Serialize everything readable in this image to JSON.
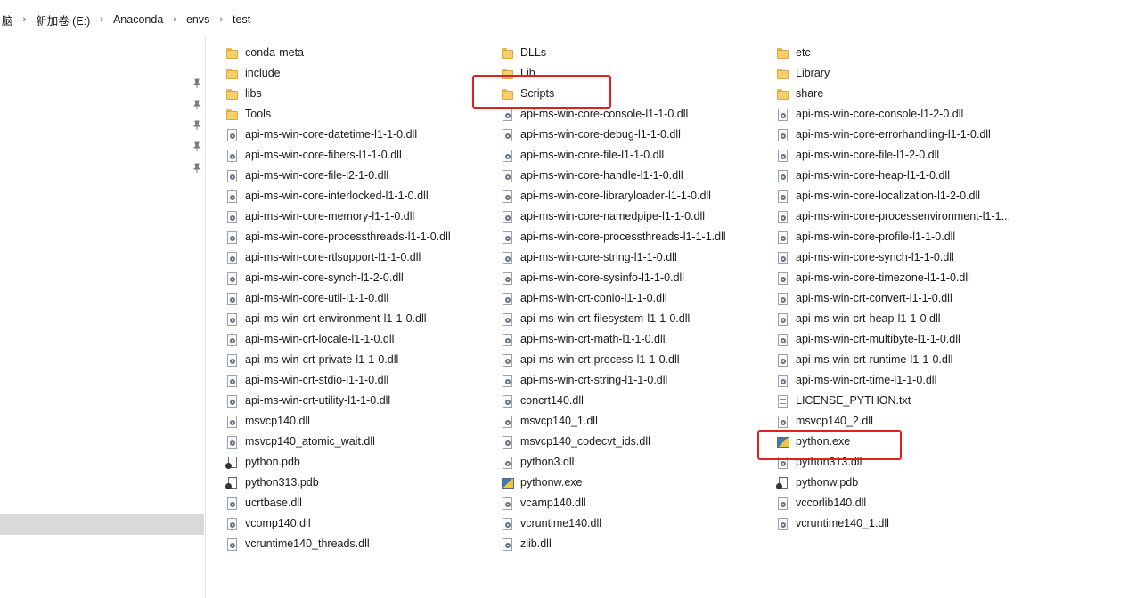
{
  "breadcrumb": [
    "脑",
    "新加卷 (E:)",
    "Anaconda",
    "envs",
    "test"
  ],
  "columns": [
    [
      {
        "name": "conda-meta",
        "type": "folder"
      },
      {
        "name": "include",
        "type": "folder"
      },
      {
        "name": "libs",
        "type": "folder"
      },
      {
        "name": "Tools",
        "type": "folder"
      },
      {
        "name": "api-ms-win-core-datetime-l1-1-0.dll",
        "type": "dll"
      },
      {
        "name": "api-ms-win-core-fibers-l1-1-0.dll",
        "type": "dll"
      },
      {
        "name": "api-ms-win-core-file-l2-1-0.dll",
        "type": "dll"
      },
      {
        "name": "api-ms-win-core-interlocked-l1-1-0.dll",
        "type": "dll"
      },
      {
        "name": "api-ms-win-core-memory-l1-1-0.dll",
        "type": "dll"
      },
      {
        "name": "api-ms-win-core-processthreads-l1-1-0.dll",
        "type": "dll"
      },
      {
        "name": "api-ms-win-core-rtlsupport-l1-1-0.dll",
        "type": "dll"
      },
      {
        "name": "api-ms-win-core-synch-l1-2-0.dll",
        "type": "dll"
      },
      {
        "name": "api-ms-win-core-util-l1-1-0.dll",
        "type": "dll"
      },
      {
        "name": "api-ms-win-crt-environment-l1-1-0.dll",
        "type": "dll"
      },
      {
        "name": "api-ms-win-crt-locale-l1-1-0.dll",
        "type": "dll"
      },
      {
        "name": "api-ms-win-crt-private-l1-1-0.dll",
        "type": "dll"
      },
      {
        "name": "api-ms-win-crt-stdio-l1-1-0.dll",
        "type": "dll"
      },
      {
        "name": "api-ms-win-crt-utility-l1-1-0.dll",
        "type": "dll"
      },
      {
        "name": "msvcp140.dll",
        "type": "dll"
      },
      {
        "name": "msvcp140_atomic_wait.dll",
        "type": "dll"
      },
      {
        "name": "python.pdb",
        "type": "pdb"
      },
      {
        "name": "python313.pdb",
        "type": "pdb"
      },
      {
        "name": "ucrtbase.dll",
        "type": "dll"
      },
      {
        "name": "vcomp140.dll",
        "type": "dll"
      },
      {
        "name": "vcruntime140_threads.dll",
        "type": "dll"
      }
    ],
    [
      {
        "name": "DLLs",
        "type": "folder"
      },
      {
        "name": "Lib",
        "type": "folder"
      },
      {
        "name": "Scripts",
        "type": "folder"
      },
      {
        "name": "api-ms-win-core-console-l1-1-0.dll",
        "type": "dll"
      },
      {
        "name": "api-ms-win-core-debug-l1-1-0.dll",
        "type": "dll"
      },
      {
        "name": "api-ms-win-core-file-l1-1-0.dll",
        "type": "dll"
      },
      {
        "name": "api-ms-win-core-handle-l1-1-0.dll",
        "type": "dll"
      },
      {
        "name": "api-ms-win-core-libraryloader-l1-1-0.dll",
        "type": "dll"
      },
      {
        "name": "api-ms-win-core-namedpipe-l1-1-0.dll",
        "type": "dll"
      },
      {
        "name": "api-ms-win-core-processthreads-l1-1-1.dll",
        "type": "dll"
      },
      {
        "name": "api-ms-win-core-string-l1-1-0.dll",
        "type": "dll"
      },
      {
        "name": "api-ms-win-core-sysinfo-l1-1-0.dll",
        "type": "dll"
      },
      {
        "name": "api-ms-win-crt-conio-l1-1-0.dll",
        "type": "dll"
      },
      {
        "name": "api-ms-win-crt-filesystem-l1-1-0.dll",
        "type": "dll"
      },
      {
        "name": "api-ms-win-crt-math-l1-1-0.dll",
        "type": "dll"
      },
      {
        "name": "api-ms-win-crt-process-l1-1-0.dll",
        "type": "dll"
      },
      {
        "name": "api-ms-win-crt-string-l1-1-0.dll",
        "type": "dll"
      },
      {
        "name": "concrt140.dll",
        "type": "dll"
      },
      {
        "name": "msvcp140_1.dll",
        "type": "dll"
      },
      {
        "name": "msvcp140_codecvt_ids.dll",
        "type": "dll"
      },
      {
        "name": "python3.dll",
        "type": "dll"
      },
      {
        "name": "pythonw.exe",
        "type": "exe"
      },
      {
        "name": "vcamp140.dll",
        "type": "dll"
      },
      {
        "name": "vcruntime140.dll",
        "type": "dll"
      },
      {
        "name": "zlib.dll",
        "type": "dll"
      }
    ],
    [
      {
        "name": "etc",
        "type": "folder"
      },
      {
        "name": "Library",
        "type": "folder"
      },
      {
        "name": "share",
        "type": "folder"
      },
      {
        "name": "api-ms-win-core-console-l1-2-0.dll",
        "type": "dll"
      },
      {
        "name": "api-ms-win-core-errorhandling-l1-1-0.dll",
        "type": "dll"
      },
      {
        "name": "api-ms-win-core-file-l1-2-0.dll",
        "type": "dll"
      },
      {
        "name": "api-ms-win-core-heap-l1-1-0.dll",
        "type": "dll"
      },
      {
        "name": "api-ms-win-core-localization-l1-2-0.dll",
        "type": "dll"
      },
      {
        "name": "api-ms-win-core-processenvironment-l1-1...",
        "type": "dll"
      },
      {
        "name": "api-ms-win-core-profile-l1-1-0.dll",
        "type": "dll"
      },
      {
        "name": "api-ms-win-core-synch-l1-1-0.dll",
        "type": "dll"
      },
      {
        "name": "api-ms-win-core-timezone-l1-1-0.dll",
        "type": "dll"
      },
      {
        "name": "api-ms-win-crt-convert-l1-1-0.dll",
        "type": "dll"
      },
      {
        "name": "api-ms-win-crt-heap-l1-1-0.dll",
        "type": "dll"
      },
      {
        "name": "api-ms-win-crt-multibyte-l1-1-0.dll",
        "type": "dll"
      },
      {
        "name": "api-ms-win-crt-runtime-l1-1-0.dll",
        "type": "dll"
      },
      {
        "name": "api-ms-win-crt-time-l1-1-0.dll",
        "type": "dll"
      },
      {
        "name": "LICENSE_PYTHON.txt",
        "type": "txt"
      },
      {
        "name": "msvcp140_2.dll",
        "type": "dll"
      },
      {
        "name": "python.exe",
        "type": "exe"
      },
      {
        "name": "python313.dll",
        "type": "dll"
      },
      {
        "name": "pythonw.pdb",
        "type": "pdb"
      },
      {
        "name": "vccorlib140.dll",
        "type": "dll"
      },
      {
        "name": "vcruntime140_1.dll",
        "type": "dll"
      }
    ]
  ],
  "icons": {
    "folder": "folder-icon",
    "dll": "dll-file-icon",
    "pdb": "pdb-file-icon",
    "txt": "text-file-icon",
    "exe": "python-exe-icon",
    "pin": "pin-icon"
  },
  "highlight_color": "#e02020"
}
